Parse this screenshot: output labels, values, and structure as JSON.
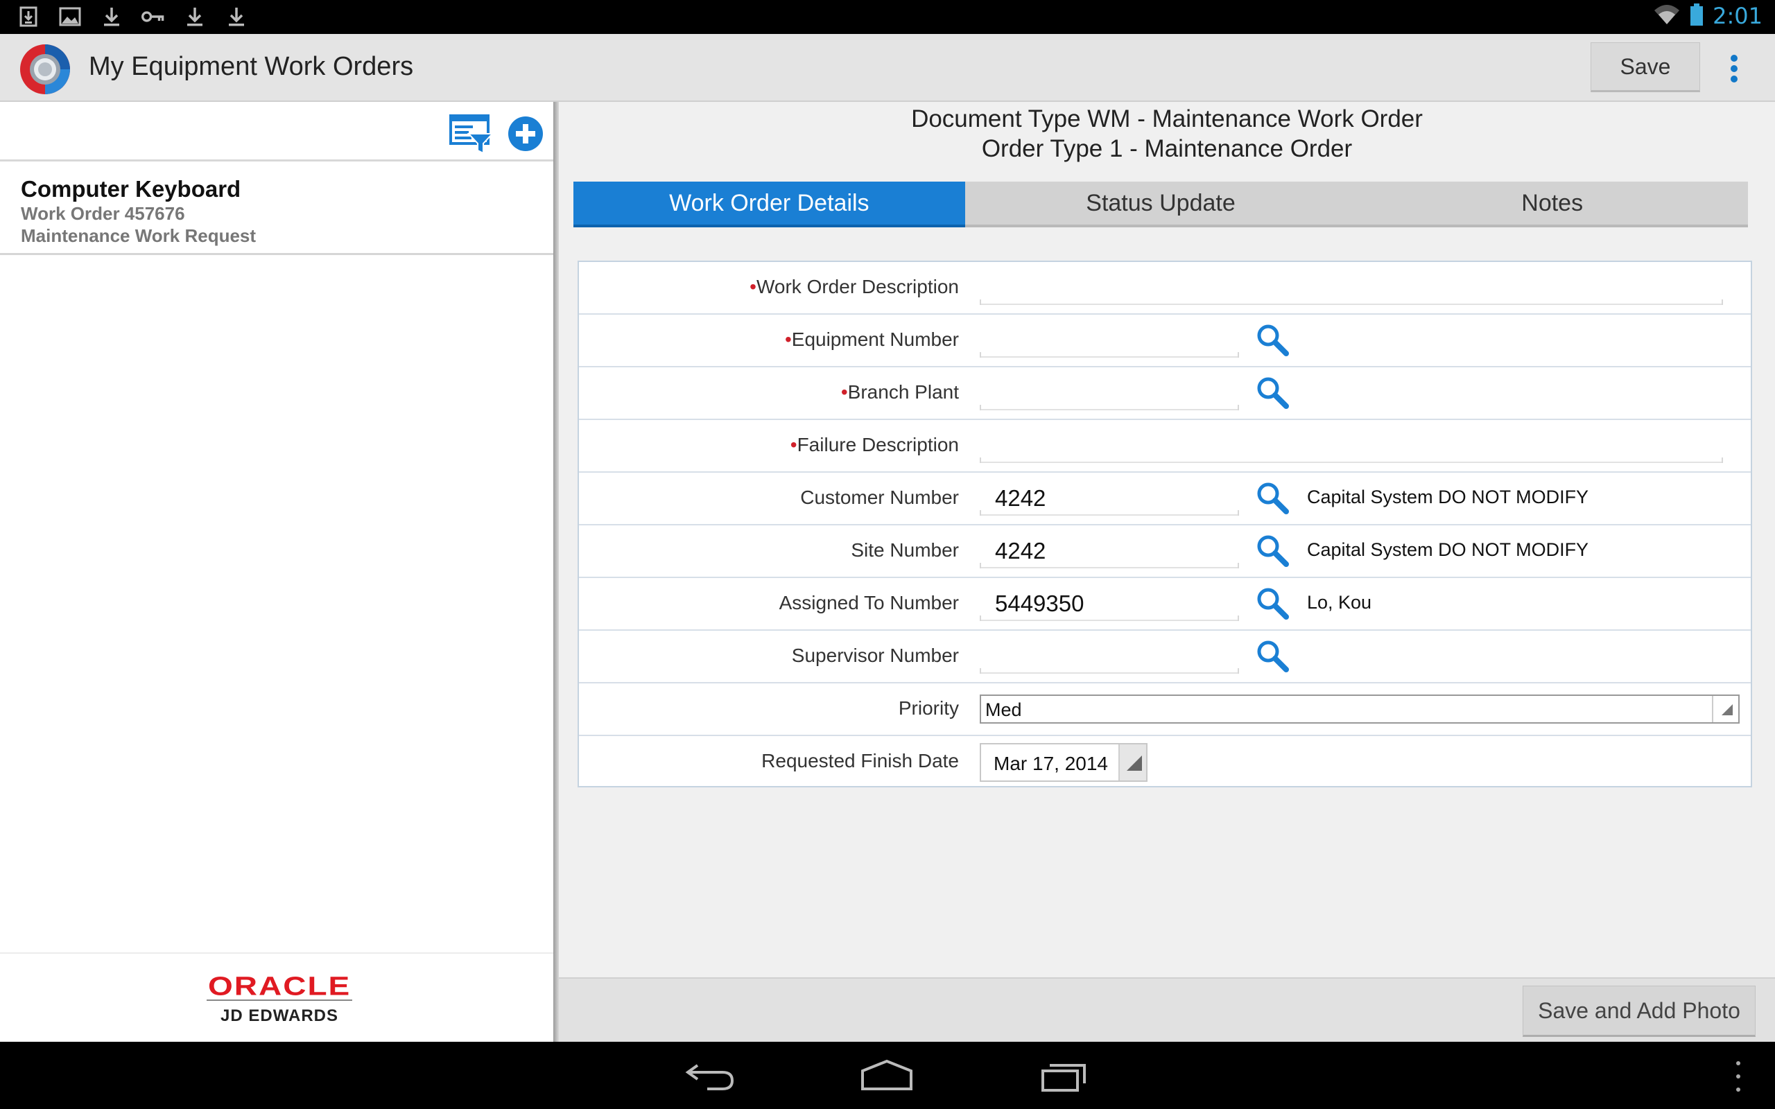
{
  "status_bar": {
    "time": "2:01",
    "notification_icons": [
      "download-box-icon",
      "image-icon",
      "download-icon",
      "key-icon",
      "download-icon",
      "download-icon"
    ]
  },
  "action_bar": {
    "title": "My Equipment Work Orders",
    "save_label": "Save"
  },
  "list": {
    "items": [
      {
        "title": "Computer Keyboard",
        "line1": "Work Order 457676",
        "line2": "Maintenance Work Request"
      }
    ]
  },
  "footer": {
    "brand": "ORACLE",
    "brand_sub": "JD EDWARDS"
  },
  "document": {
    "line1": "Document Type WM - Maintenance Work Order",
    "line2": "Order Type 1 - Maintenance Order"
  },
  "tabs": [
    {
      "label": "Work Order Details",
      "active": true
    },
    {
      "label": "Status Update",
      "active": false
    },
    {
      "label": "Notes",
      "active": false
    }
  ],
  "form": {
    "work_order_description": {
      "label": "Work Order Description",
      "required": true,
      "value": ""
    },
    "equipment_number": {
      "label": "Equipment Number",
      "required": true,
      "value": ""
    },
    "branch_plant": {
      "label": "Branch Plant",
      "required": true,
      "value": ""
    },
    "failure_description": {
      "label": "Failure Description",
      "required": true,
      "value": ""
    },
    "customer_number": {
      "label": "Customer Number",
      "value": "4242",
      "description": "Capital System DO NOT MODIFY"
    },
    "site_number": {
      "label": "Site Number",
      "value": "4242",
      "description": "Capital System DO NOT MODIFY"
    },
    "assigned_to_number": {
      "label": "Assigned To Number",
      "value": "5449350",
      "description": "Lo, Kou"
    },
    "supervisor_number": {
      "label": "Supervisor Number",
      "value": ""
    },
    "priority": {
      "label": "Priority",
      "value": "Med"
    },
    "requested_finish_date": {
      "label": "Requested Finish Date",
      "value": "Mar 17, 2014"
    }
  },
  "bottom": {
    "save_photo_label": "Save and Add Photo"
  },
  "colors": {
    "accent": "#1a7fd4",
    "required": "#d0202a",
    "brand": "#e01a22"
  }
}
